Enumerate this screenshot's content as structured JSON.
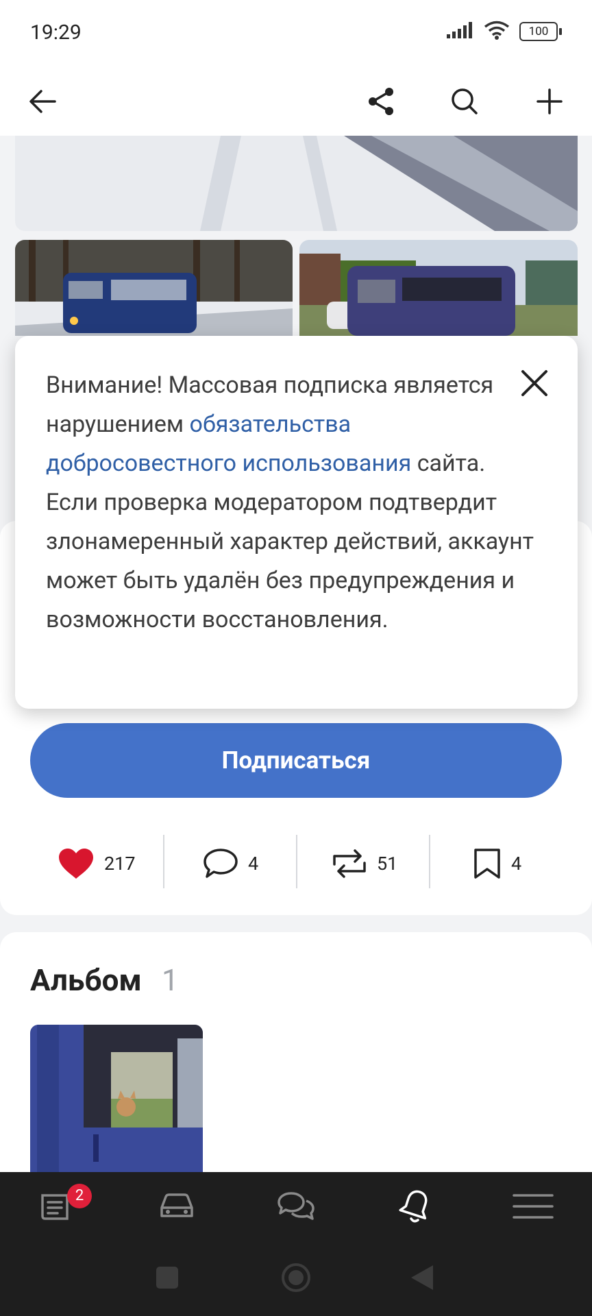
{
  "status_bar": {
    "time": "19:29",
    "battery": "100"
  },
  "toolbar": {
    "icons": [
      "back-arrow-icon",
      "share-icon",
      "search-icon",
      "plus-icon"
    ]
  },
  "popup": {
    "text_before_link": "Внимание! Массовая подписка является нарушением ",
    "link_text": "обязательства добросовестного использования",
    "text_after_link": " сайта. Если проверка модератором подтвердит злонамеренный характер действий, аккаунт может быть удалён без предупреждения и возможности восстановления."
  },
  "subscribe_button": {
    "label": "Подписаться"
  },
  "stats": {
    "likes": "217",
    "comments": "4",
    "reposts": "51",
    "bookmarks": "4"
  },
  "album": {
    "title": "Альбом",
    "count": "1"
  },
  "bottom_nav": {
    "items": [
      "feed-icon",
      "car-icon",
      "chat-icon",
      "bell-icon",
      "menu-icon"
    ],
    "feed_badge": "2"
  },
  "colors": {
    "accent": "#4472c9",
    "link": "#2f5fa6",
    "like": "#e0203a",
    "nav_bg": "#1e1e1e"
  }
}
